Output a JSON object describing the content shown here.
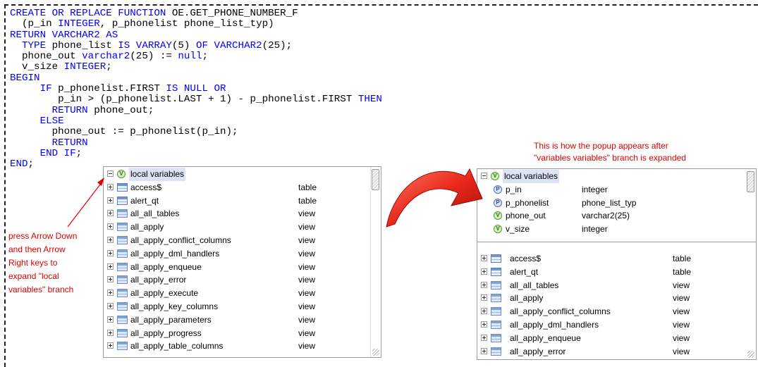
{
  "code_lines": [
    [
      [
        "kw",
        "CREATE OR REPLACE FUNCTION "
      ],
      [
        "str",
        "OE.GET_PHONE_NUMBER_F"
      ]
    ],
    [
      [
        "str",
        "  (p_in "
      ],
      [
        "kw",
        "INTEGER"
      ],
      [
        "str",
        ", p_phonelist phone_list_typ)"
      ]
    ],
    [
      [
        "kw",
        "RETURN VARCHAR2 AS"
      ]
    ],
    [
      [
        "str",
        "  "
      ],
      [
        "kw",
        "TYPE"
      ],
      [
        "str",
        " phone_list "
      ],
      [
        "kw",
        "IS VARRAY"
      ],
      [
        "str",
        "(5) "
      ],
      [
        "kw",
        "OF VARCHAR2"
      ],
      [
        "str",
        "(25);"
      ]
    ],
    [
      [
        "str",
        "  phone_out "
      ],
      [
        "kw",
        "varchar2"
      ],
      [
        "str",
        "(25) := "
      ],
      [
        "kw",
        "null"
      ],
      [
        "str",
        ";"
      ]
    ],
    [
      [
        "str",
        "  v_size "
      ],
      [
        "kw",
        "INTEGER"
      ],
      [
        "str",
        ";"
      ]
    ],
    [
      [
        "kw",
        "BEGIN"
      ]
    ],
    [
      [
        "str",
        "     "
      ],
      [
        "kw",
        "IF"
      ],
      [
        "str",
        " p_phonelist.FIRST "
      ],
      [
        "kw",
        "IS NULL OR"
      ]
    ],
    [
      [
        "str",
        "        p_in > (p_phonelist.LAST + 1) - p_phonelist.FIRST "
      ],
      [
        "kw",
        "THEN"
      ]
    ],
    [
      [
        "str",
        "       "
      ],
      [
        "kw",
        "RETURN"
      ],
      [
        "str",
        " phone_out;"
      ]
    ],
    [
      [
        "str",
        "     "
      ],
      [
        "kw",
        "ELSE"
      ]
    ],
    [
      [
        "str",
        "       phone_out := p_phonelist(p_in);"
      ]
    ],
    [
      [
        "str",
        "       "
      ],
      [
        "kw",
        "RETURN"
      ]
    ],
    [
      [
        "str",
        "     "
      ],
      [
        "kw",
        "END IF"
      ],
      [
        "str",
        ";"
      ]
    ],
    [
      [
        "kw",
        "END"
      ],
      [
        "str",
        ";"
      ]
    ]
  ],
  "popup_left": {
    "header": "local variables",
    "items": [
      {
        "name": "access$",
        "type": "table"
      },
      {
        "name": "alert_qt",
        "type": "table"
      },
      {
        "name": "all_all_tables",
        "type": "view"
      },
      {
        "name": "all_apply",
        "type": "view"
      },
      {
        "name": "all_apply_conflict_columns",
        "type": "view"
      },
      {
        "name": "all_apply_dml_handlers",
        "type": "view"
      },
      {
        "name": "all_apply_enqueue",
        "type": "view"
      },
      {
        "name": "all_apply_error",
        "type": "view"
      },
      {
        "name": "all_apply_execute",
        "type": "view"
      },
      {
        "name": "all_apply_key_columns",
        "type": "view"
      },
      {
        "name": "all_apply_parameters",
        "type": "view"
      },
      {
        "name": "all_apply_progress",
        "type": "view"
      },
      {
        "name": "all_apply_table_columns",
        "type": "view"
      }
    ]
  },
  "popup_right": {
    "header": "local variables",
    "variables": [
      {
        "kind": "P",
        "name": "p_in",
        "type": "integer"
      },
      {
        "kind": "P",
        "name": "p_phonelist",
        "type": "phone_list_typ"
      },
      {
        "kind": "V",
        "name": "phone_out",
        "type": "varchar2(25)"
      },
      {
        "kind": "V",
        "name": "v_size",
        "type": "integer"
      }
    ],
    "items": [
      {
        "name": "access$",
        "type": "table"
      },
      {
        "name": "alert_qt",
        "type": "table"
      },
      {
        "name": "all_all_tables",
        "type": "view"
      },
      {
        "name": "all_apply",
        "type": "view"
      },
      {
        "name": "all_apply_conflict_columns",
        "type": "view"
      },
      {
        "name": "all_apply_dml_handlers",
        "type": "view"
      },
      {
        "name": "all_apply_enqueue",
        "type": "view"
      },
      {
        "name": "all_apply_error",
        "type": "view"
      }
    ]
  },
  "annotation_left": [
    "press Arrow Down",
    "and then Arrow",
    "Right keys to",
    "expand \"local",
    "variables\" branch"
  ],
  "annotation_right": [
    "This is how the popup appears after",
    "\"variables variables\" branch is expanded"
  ],
  "colors": {
    "keyword": "#0000ff",
    "annotation": "#e00000",
    "arrow": "#e8281a",
    "selection": "#dde3f7"
  }
}
